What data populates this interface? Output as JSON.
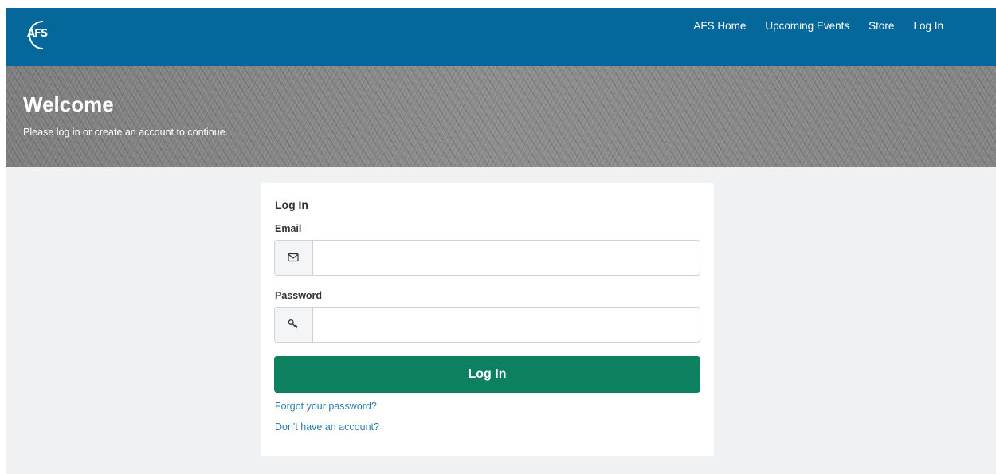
{
  "colors": {
    "navbar_bg": "#06679a",
    "page_bg": "#f0f1f3",
    "primary_button": "#0d8060",
    "link": "#2e7bb0"
  },
  "header": {
    "logo_text": "AFS",
    "nav": [
      {
        "label": "AFS Home"
      },
      {
        "label": "Upcoming Events"
      },
      {
        "label": "Store"
      },
      {
        "label": "Log In"
      }
    ]
  },
  "hero": {
    "title": "Welcome",
    "subtitle": "Please log in or create an account to continue."
  },
  "login": {
    "title": "Log In",
    "email": {
      "label": "Email",
      "value": "",
      "icon": "envelope-icon"
    },
    "password": {
      "label": "Password",
      "value": "",
      "icon": "key-icon"
    },
    "submit_label": "Log In",
    "forgot_label": "Forgot your password?",
    "register_label": "Don't have an account?"
  }
}
